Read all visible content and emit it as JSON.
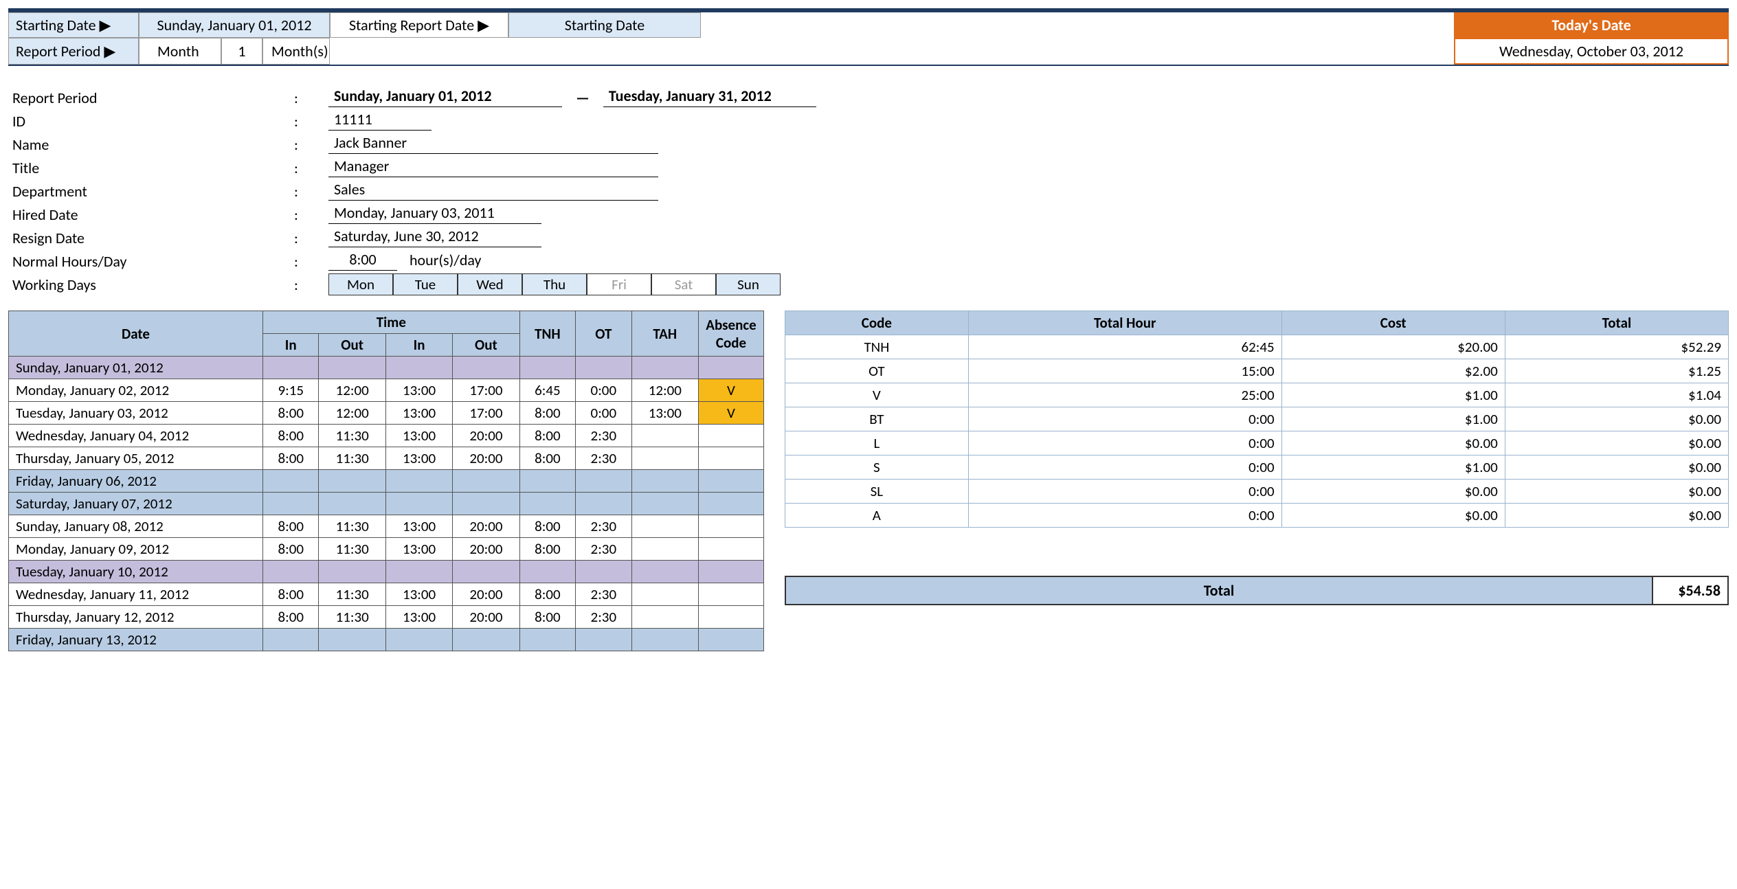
{
  "topbar": {
    "startingDateLabel": "Starting Date ▶",
    "startingDateValue": "Sunday, January 01, 2012",
    "startingReportLabel": "Starting Report Date ▶",
    "startingReportValue": "Starting Date",
    "periodLabel": "Report Period ▶",
    "periodUnit": "Month",
    "periodQty": "1",
    "periodUnitPl": "Month(s)",
    "todayLabel": "Today's Date",
    "todayValue": "Wednesday, October 03, 2012"
  },
  "info": {
    "reportPeriodLabel": "Report Period",
    "reportStart": "Sunday, January 01, 2012",
    "reportEnd": "Tuesday, January 31, 2012",
    "idLabel": "ID",
    "id": "11111",
    "nameLabel": "Name",
    "name": "Jack Banner",
    "titleLabel": "Title",
    "title": "Manager",
    "deptLabel": "Department",
    "dept": "Sales",
    "hiredLabel": "Hired Date",
    "hired": "Monday, January 03, 2011",
    "resignLabel": "Resign Date",
    "resign": "Saturday, June 30, 2012",
    "hoursLabel": "Normal Hours/Day",
    "hoursVal": "8:00",
    "hoursUnit": "hour(s)/day",
    "wdLabel": "Working Days",
    "days": [
      "Mon",
      "Tue",
      "Wed",
      "Thu",
      "Fri",
      "Sat",
      "Sun"
    ],
    "daysOn": [
      true,
      true,
      true,
      true,
      false,
      false,
      true
    ]
  },
  "attHeaders": {
    "date": "Date",
    "time": "Time",
    "in": "In",
    "out": "Out",
    "tnh": "TNH",
    "ot": "OT",
    "tah": "TAH",
    "abs": "Absence Code"
  },
  "attRows": [
    {
      "date": "Sunday, January 01, 2012",
      "style": "purple"
    },
    {
      "date": "Monday, January 02, 2012",
      "in1": "9:15",
      "out1": "12:00",
      "in2": "13:00",
      "out2": "17:00",
      "tnh": "6:45",
      "ot": "0:00",
      "tah": "12:00",
      "abs": "V"
    },
    {
      "date": "Tuesday, January 03, 2012",
      "in1": "8:00",
      "out1": "12:00",
      "in2": "13:00",
      "out2": "17:00",
      "tnh": "8:00",
      "ot": "0:00",
      "tah": "13:00",
      "abs": "V"
    },
    {
      "date": "Wednesday, January 04, 2012",
      "in1": "8:00",
      "out1": "11:30",
      "in2": "13:00",
      "out2": "20:00",
      "tnh": "8:00",
      "ot": "2:30"
    },
    {
      "date": "Thursday, January 05, 2012",
      "in1": "8:00",
      "out1": "11:30",
      "in2": "13:00",
      "out2": "20:00",
      "tnh": "8:00",
      "ot": "2:30"
    },
    {
      "date": "Friday, January 06, 2012",
      "style": "blue"
    },
    {
      "date": "Saturday, January 07, 2012",
      "style": "blue"
    },
    {
      "date": "Sunday, January 08, 2012",
      "in1": "8:00",
      "out1": "11:30",
      "in2": "13:00",
      "out2": "20:00",
      "tnh": "8:00",
      "ot": "2:30"
    },
    {
      "date": "Monday, January 09, 2012",
      "in1": "8:00",
      "out1": "11:30",
      "in2": "13:00",
      "out2": "20:00",
      "tnh": "8:00",
      "ot": "2:30"
    },
    {
      "date": "Tuesday, January 10, 2012",
      "style": "purple"
    },
    {
      "date": "Wednesday, January 11, 2012",
      "in1": "8:00",
      "out1": "11:30",
      "in2": "13:00",
      "out2": "20:00",
      "tnh": "8:00",
      "ot": "2:30"
    },
    {
      "date": "Thursday, January 12, 2012",
      "in1": "8:00",
      "out1": "11:30",
      "in2": "13:00",
      "out2": "20:00",
      "tnh": "8:00",
      "ot": "2:30"
    },
    {
      "date": "Friday, January 13, 2012",
      "style": "blue"
    }
  ],
  "sumHeaders": {
    "code": "Code",
    "hour": "Total Hour",
    "cost": "Cost",
    "total": "Total"
  },
  "sumRows": [
    {
      "code": "TNH",
      "hour": "62:45",
      "cost": "$20.00",
      "total": "$52.29"
    },
    {
      "code": "OT",
      "hour": "15:00",
      "cost": "$2.00",
      "total": "$1.25"
    },
    {
      "code": "V",
      "hour": "25:00",
      "cost": "$1.00",
      "total": "$1.04"
    },
    {
      "code": "BT",
      "hour": "0:00",
      "cost": "$1.00",
      "total": "$0.00"
    },
    {
      "code": "L",
      "hour": "0:00",
      "cost": "$0.00",
      "total": "$0.00"
    },
    {
      "code": "S",
      "hour": "0:00",
      "cost": "$1.00",
      "total": "$0.00"
    },
    {
      "code": "SL",
      "hour": "0:00",
      "cost": "$0.00",
      "total": "$0.00"
    },
    {
      "code": "A",
      "hour": "0:00",
      "cost": "$0.00",
      "total": "$0.00"
    }
  ],
  "grandTotal": {
    "label": "Total",
    "value": "$54.58"
  }
}
